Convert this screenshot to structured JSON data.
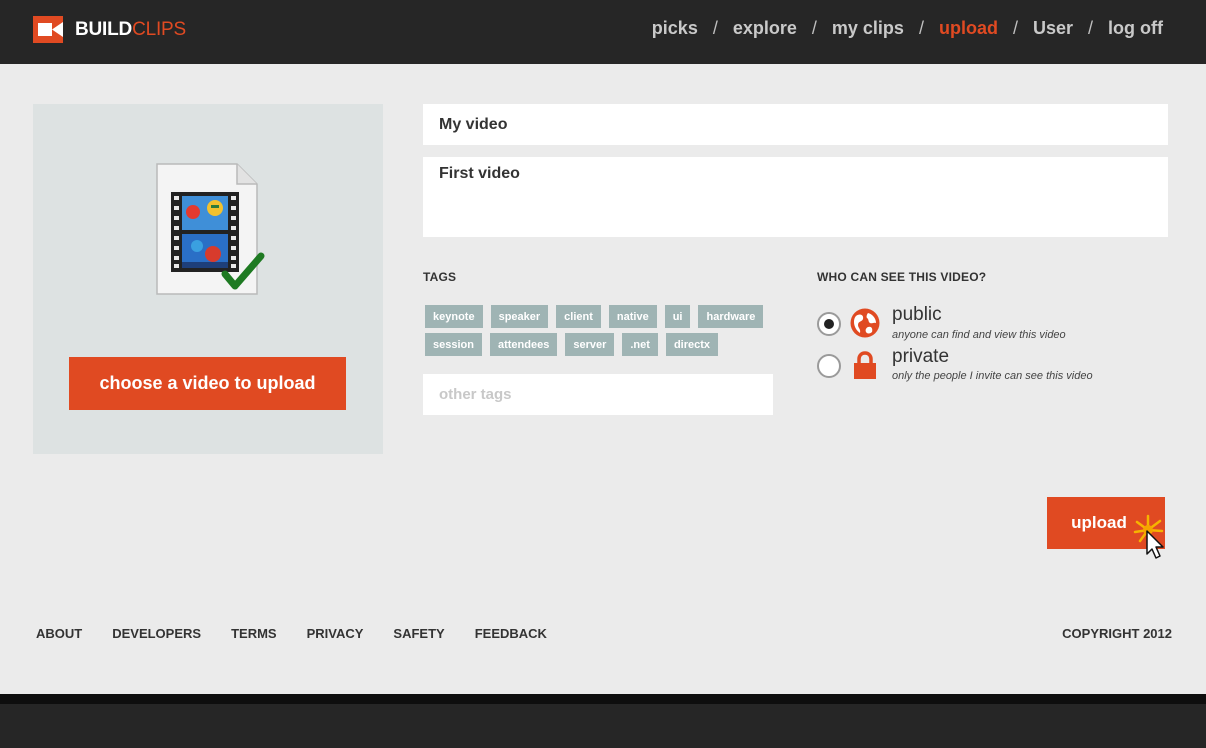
{
  "brand": {
    "name_primary": "BUILD",
    "name_secondary": "CLIPS",
    "icon": "video-camera-icon",
    "accent_color": "#e04a22"
  },
  "nav": {
    "items": [
      {
        "label": "picks",
        "active": false
      },
      {
        "label": "explore",
        "active": false
      },
      {
        "label": "my clips",
        "active": false
      },
      {
        "label": "upload",
        "active": true
      },
      {
        "label": "User",
        "active": false
      },
      {
        "label": "log off",
        "active": false
      }
    ],
    "separator": "/"
  },
  "file_panel": {
    "thumbnail_icon": "video-file-check-icon",
    "choose_button": "choose a video to upload"
  },
  "form": {
    "title_value": "My video",
    "description_value": "First video",
    "tags_heading": "TAGS",
    "tags_row1": [
      "keynote",
      "speaker",
      "client",
      "native",
      "ui",
      "hardware"
    ],
    "tags_row2": [
      "session",
      "attendees",
      "server",
      ".net",
      "directx"
    ],
    "other_tags_placeholder": "other tags",
    "visibility_heading": "WHO CAN SEE THIS VIDEO?",
    "visibility_options": [
      {
        "label": "public",
        "description": "anyone can find and view this video",
        "icon": "globe-icon",
        "selected": true
      },
      {
        "label": "private",
        "description": "only the people I invite can see this video",
        "icon": "lock-icon",
        "selected": false
      }
    ],
    "upload_button": "upload"
  },
  "footer": {
    "links": [
      "ABOUT",
      "DEVELOPERS",
      "TERMS",
      "PRIVACY",
      "SAFETY",
      "FEEDBACK"
    ],
    "copyright": "COPYRIGHT 2012"
  }
}
